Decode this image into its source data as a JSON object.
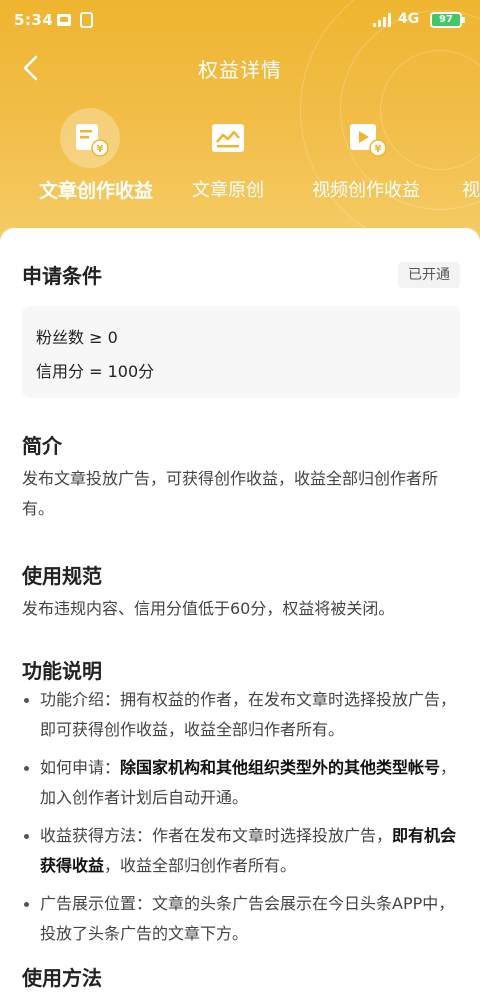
{
  "status_bar": {
    "time": "5:34",
    "network": "4G",
    "battery": "97"
  },
  "header": {
    "title": "权益详情"
  },
  "tabs": [
    {
      "label": "文章创作收益",
      "icon": "article-income-icon",
      "active": true
    },
    {
      "label": "文章原创",
      "icon": "original-article-icon",
      "active": false
    },
    {
      "label": "视频创作收益",
      "icon": "video-income-icon",
      "active": false
    },
    {
      "label": "视",
      "icon": "",
      "active": false
    }
  ],
  "conditions": {
    "title": "申请条件",
    "status_badge": "已开通",
    "items": [
      "粉丝数 ≥ 0",
      "信用分 = 100分"
    ]
  },
  "intro": {
    "title": "简介",
    "text": "发布文章投放广告，可获得创作收益，收益全部归创作者所有。"
  },
  "rules": {
    "title": "使用规范",
    "text": "发布违规内容、信用分值低于60分，权益将被关闭。"
  },
  "features": {
    "title": "功能说明",
    "items": [
      {
        "prefix": "功能介绍：拥有权益的作者，在发布文章时选择投放广告，即可获得创作收益，收益全部归作者所有。",
        "bold": "",
        "suffix": ""
      },
      {
        "prefix": "如何申请：",
        "bold": "除国家机构和其他组织类型外的其他类型帐号",
        "suffix": "，加入创作者计划后自动开通。"
      },
      {
        "prefix": "收益获得方法：作者在发布文章时选择投放广告，",
        "bold": "即有机会获得收益",
        "suffix": "，收益全部归创作者所有。"
      },
      {
        "prefix": "广告展示位置：文章的头条广告会展示在今日头条APP中，投放了头条广告的文章下方。",
        "bold": "",
        "suffix": ""
      }
    ]
  },
  "usage": {
    "title": "使用方法"
  },
  "colors": {
    "header_gradient_top": "#efb530",
    "header_gradient_bottom": "#f6cd68",
    "battery_green": "#44c767"
  }
}
